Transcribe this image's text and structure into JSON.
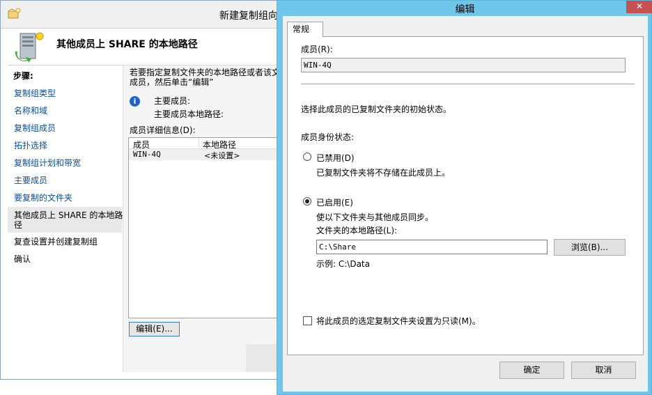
{
  "background_window": {
    "title": "新建复制组向",
    "header_title": "其他成员上 SHARE 的本地路径",
    "steps_heading": "步骤:",
    "steps": [
      {
        "label": "复制组类型",
        "current": false
      },
      {
        "label": "名称和域",
        "current": false
      },
      {
        "label": "复制组成员",
        "current": false
      },
      {
        "label": "拓扑选择",
        "current": false
      },
      {
        "label": "复制组计划和带宽",
        "current": false
      },
      {
        "label": "主要成员",
        "current": false
      },
      {
        "label": "要复制的文件夹",
        "current": false
      },
      {
        "label": "其他成员上 SHARE 的本地路\n径",
        "current": true
      },
      {
        "label": "复查设置并创建复制组",
        "current": false
      },
      {
        "label": "确认",
        "current": false
      }
    ],
    "instruction": "若要指定复制文件夹的本地路径或者该文\n成员，然后单击“编辑”",
    "primary_member_label": "主要成员:",
    "primary_member_path_label": "主要成员本地路径:",
    "member_details_label": "成员详细信息(D):",
    "grid": {
      "columns": [
        "成员",
        "本地路径"
      ],
      "rows": [
        [
          "WIN-4Q",
          "<未设置>"
        ]
      ]
    },
    "edit_button": "编辑(E)..."
  },
  "dialog": {
    "title": "编辑",
    "close_glyph": "✕",
    "tab": "常规",
    "member_label": "成员(R):",
    "member_value": "WIN-4Q",
    "initial_state_text": "选择此成员的已复制文件夹的初始状态。",
    "membership_status_label": "成员身份状态:",
    "disabled_option": {
      "label": "已禁用(D)",
      "description": "已复制文件夹将不存储在此成员上。",
      "selected": false
    },
    "enabled_option": {
      "label": "已启用(E)",
      "description": "使以下文件夹与其他成员同步。",
      "selected": true
    },
    "local_path_label": "文件夹的本地路径(L):",
    "local_path_value": "C:\\Share",
    "browse_button": "浏览(B)...",
    "example_text": "示例: C:\\Data",
    "readonly_label": "将此成员的选定复制文件夹设置为只读(M)。",
    "readonly_checked": false,
    "ok_button": "确定",
    "cancel_button": "取消"
  },
  "colors": {
    "dialog_frame": "#6ec6ea",
    "link_blue": "#0b4e9a",
    "info_blue": "#1f63c3",
    "close_red": "#c75050",
    "focus_border": "#2f7fd4"
  },
  "icons": [
    "wizard-icon",
    "server-replication-icon",
    "info-icon",
    "close-icon"
  ]
}
